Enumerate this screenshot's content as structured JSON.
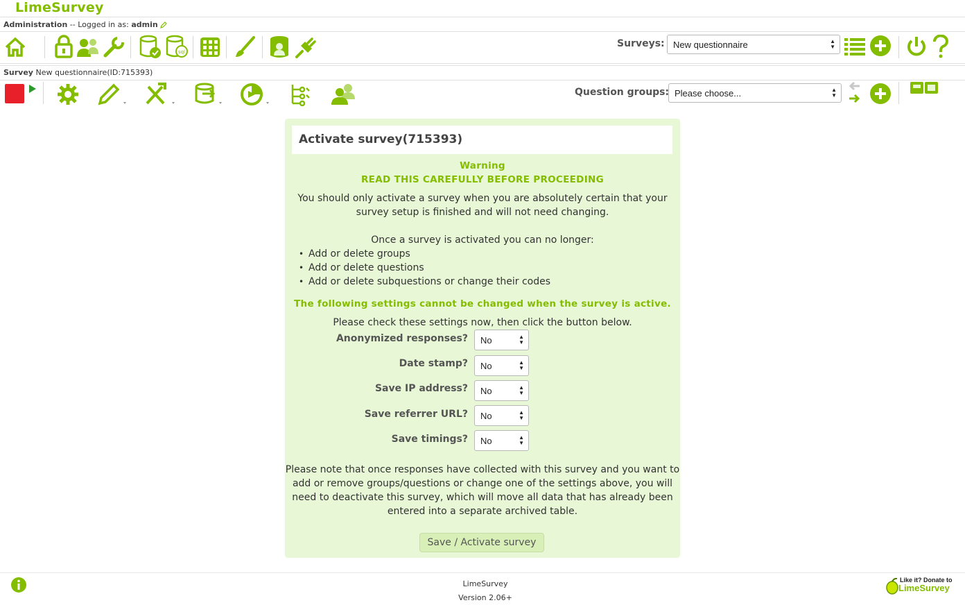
{
  "app": {
    "title": "LimeSurvey"
  },
  "admin_bar": {
    "label": "Administration",
    "separator": "-- Logged in as:",
    "username": "admin"
  },
  "toolbar1": {
    "surveys_label": "Surveys:",
    "surveys_selected": "New questionnaire",
    "icons": [
      "home-icon",
      "lock-icon",
      "users-icon",
      "wrench-icon",
      "database-check-icon",
      "database-sql-icon",
      "grid-icon",
      "brush-icon",
      "database-user-icon",
      "plugin-icon",
      "list-icon",
      "add-survey-icon",
      "logout-icon",
      "help-icon"
    ]
  },
  "survey_bar": {
    "label": "Survey",
    "name": "New questionnaire(ID:715393)"
  },
  "toolbar2": {
    "question_groups_label": "Question groups:",
    "question_groups_selected": "Please choose...",
    "icons": [
      "stop-icon",
      "play-icon",
      "gear-icon",
      "pencil-icon",
      "tools-icon",
      "responses-icon",
      "quotas-icon",
      "organize-icon",
      "participants-icon",
      "nav-arrows-icon",
      "add-group-icon",
      "layout-toggle-icon"
    ]
  },
  "panel": {
    "title": "Activate survey(715393)",
    "warning": "Warning",
    "warning_sub": "READ THIS CAREFULLY BEFORE PROCEEDING",
    "intro_line1": "You should only activate a survey when you are absolutely certain that your",
    "intro_line2": "survey setup is finished and will not need changing.",
    "once_activated": "Once a survey is activated you can no longer:",
    "bullets": [
      "Add or delete groups",
      "Add or delete questions",
      "Add or delete subquestions or change their codes"
    ],
    "settings_warning": "The following settings cannot be changed when the survey is active.",
    "check_settings": "Please check these settings now, then click the button below.",
    "settings": [
      {
        "label": "Anonymized responses?",
        "value": "No"
      },
      {
        "label": "Date stamp?",
        "value": "No"
      },
      {
        "label": "Save IP address?",
        "value": "No"
      },
      {
        "label": "Save referrer URL?",
        "value": "No"
      },
      {
        "label": "Save timings?",
        "value": "No"
      }
    ],
    "note_line1": "Please note that once responses have collected with this survey and you want to",
    "note_line2": "add or remove groups/questions or change one of the settings above, you will",
    "note_line3": "need to deactivate this survey, which will move all data that has already been",
    "note_line4": "entered into a separate archived table.",
    "activate_button": "Save / Activate survey"
  },
  "footer": {
    "brand": "LimeSurvey",
    "version": "Version 2.06+",
    "donate_top": "Like it? Donate to",
    "donate_brand": "LimeSurvey"
  },
  "colors": {
    "accent": "#84bd00",
    "panel_bg": "#e8f7d5",
    "button_bg": "#d8efb8",
    "stop": "#e8202a"
  }
}
